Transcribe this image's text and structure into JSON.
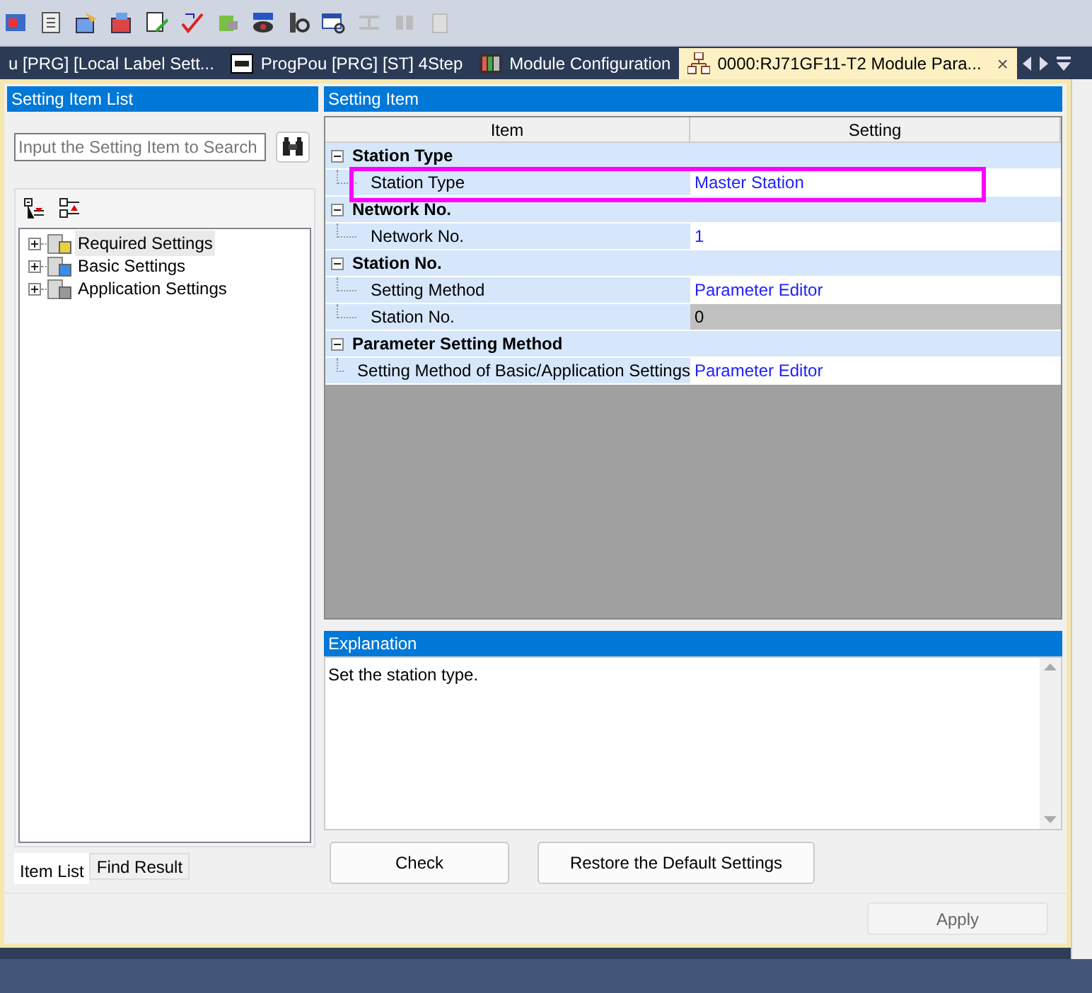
{
  "doc_tabs": [
    {
      "label": "u [PRG] [Local Label Sett...",
      "kind": "plain",
      "selected": false
    },
    {
      "label": "ProgPou [PRG] [ST] 4Step",
      "kind": "script",
      "selected": false
    },
    {
      "label": "Module Configuration",
      "kind": "rack",
      "selected": false
    },
    {
      "label": "0000:RJ71GF11-T2 Module Para...",
      "kind": "network",
      "selected": true,
      "close": "×"
    }
  ],
  "left_panel": {
    "title": "Setting Item List",
    "search": {
      "placeholder": "Input the Setting Item to Search"
    },
    "tree": [
      {
        "label": "Required Settings",
        "expanded": false,
        "selected": true
      },
      {
        "label": "Basic Settings",
        "expanded": false,
        "selected": false
      },
      {
        "label": "Application Settings",
        "expanded": false,
        "selected": false
      }
    ],
    "tabs": [
      {
        "label": "Item List",
        "selected": true
      },
      {
        "label": "Find Result",
        "selected": false
      }
    ]
  },
  "right_panel": {
    "title": "Setting Item",
    "columns": [
      "Item",
      "Setting"
    ],
    "annotation": {
      "kind": "frame"
    },
    "groups": [
      {
        "label": "Station Type",
        "expanded": true,
        "items": [
          {
            "label": "Station Type",
            "value": "Master Station",
            "disabled": false
          }
        ]
      },
      {
        "label": "Network No.",
        "expanded": true,
        "items": [
          {
            "label": "Network No.",
            "value": "1",
            "disabled": false
          }
        ]
      },
      {
        "label": "Station No.",
        "expanded": true,
        "items": [
          {
            "label": "Setting Method",
            "value": "Parameter Editor",
            "disabled": false
          },
          {
            "label": "Station No.",
            "value": "0",
            "disabled": true
          }
        ]
      },
      {
        "label": "Parameter Setting Method",
        "expanded": true,
        "items": [
          {
            "label": "Setting Method of Basic/Application Settings",
            "value": "Parameter Editor",
            "disabled": false
          }
        ]
      }
    ],
    "explanation": {
      "title": "Explanation",
      "text": "Set the station type."
    },
    "buttons": [
      "Check",
      "Restore the Default Settings"
    ],
    "apply": {
      "label": "Apply",
      "disabled": true
    }
  }
}
